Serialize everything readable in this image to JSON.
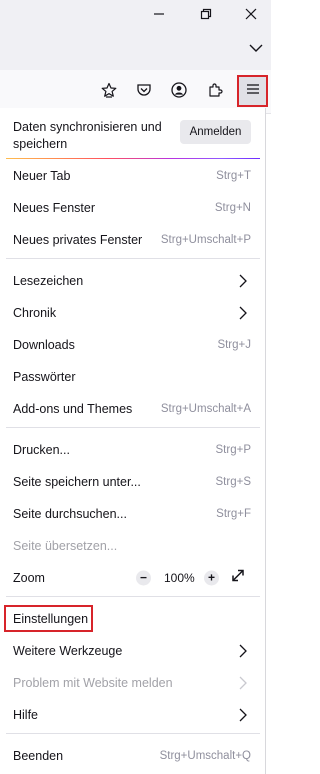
{
  "colors": {
    "highlight": "#d7242a",
    "panel_bg": "#ffffff",
    "titlebar_bg": "#f0f0f4",
    "muted_text": "#8f8f9d",
    "disabled_text": "#a2a2a8"
  },
  "window_controls": {
    "minimize_icon": "minimize-icon",
    "restore_icon": "restore-icon",
    "close_icon": "close-icon",
    "tab_list_icon": "chevron-down-icon"
  },
  "toolbar": {
    "icons": [
      "bookmark-star-icon",
      "pocket-icon",
      "account-icon",
      "extensions-icon",
      "hamburger-menu-icon"
    ]
  },
  "menu": {
    "sync": {
      "text": "Daten synchronisieren und speichern",
      "button": "Anmelden"
    },
    "new_tab": {
      "label": "Neuer Tab",
      "shortcut": "Strg+T"
    },
    "new_window": {
      "label": "Neues Fenster",
      "shortcut": "Strg+N"
    },
    "new_private_window": {
      "label": "Neues privates Fenster",
      "shortcut": "Strg+Umschalt+P"
    },
    "bookmarks": {
      "label": "Lesezeichen"
    },
    "history": {
      "label": "Chronik"
    },
    "downloads": {
      "label": "Downloads",
      "shortcut": "Strg+J"
    },
    "passwords": {
      "label": "Passwörter"
    },
    "addons": {
      "label": "Add-ons und Themes",
      "shortcut": "Strg+Umschalt+A"
    },
    "print": {
      "label": "Drucken...",
      "shortcut": "Strg+P"
    },
    "save_page": {
      "label": "Seite speichern unter...",
      "shortcut": "Strg+S"
    },
    "find": {
      "label": "Seite durchsuchen...",
      "shortcut": "Strg+F"
    },
    "translate": {
      "label": "Seite übersetzen..."
    },
    "zoom": {
      "label": "Zoom",
      "minus": "−",
      "value": "100%",
      "plus": "+"
    },
    "settings": {
      "label": "Einstellungen"
    },
    "more_tools": {
      "label": "Weitere Werkzeuge"
    },
    "report_problem": {
      "label": "Problem mit Website melden"
    },
    "help": {
      "label": "Hilfe"
    },
    "quit": {
      "label": "Beenden",
      "shortcut": "Strg+Umschalt+Q"
    }
  }
}
